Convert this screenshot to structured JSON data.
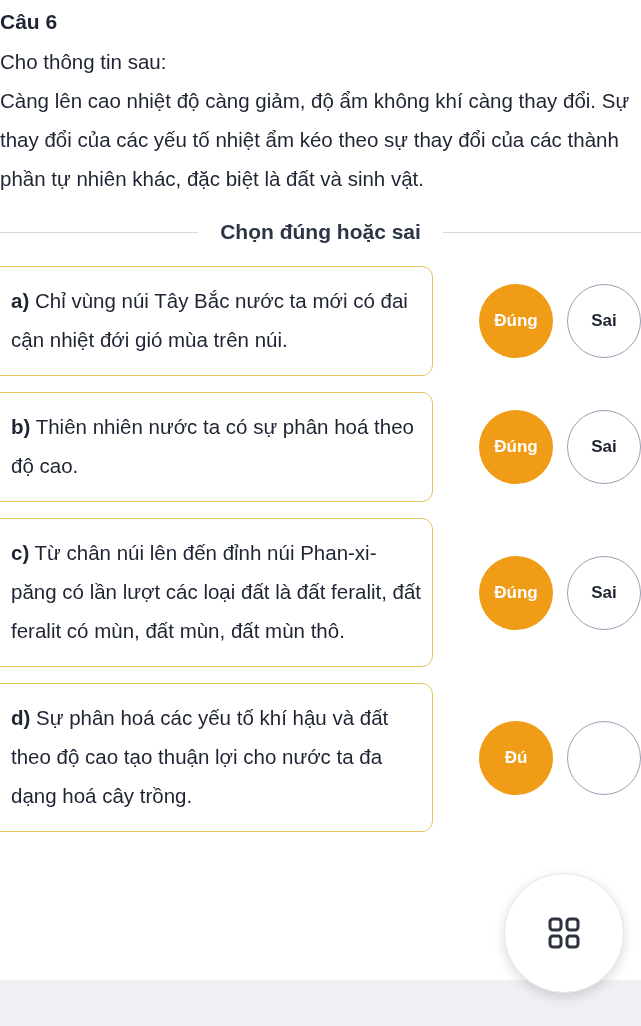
{
  "question": {
    "title": "Câu 6",
    "intro": "Cho thông tin sau:",
    "passage": "Càng lên cao nhiệt độ càng giảm, độ ẩm không khí càng thay đổi. Sự thay đổi của các yếu tố nhiệt ẩm kéo theo sự thay đổi của các thành phần tự nhiên khác, đặc biệt là đất và sinh vật."
  },
  "section_label": "Chọn đúng hoặc sai",
  "statements": [
    {
      "text": "**a)** Chỉ vùng núi Tây Bắc nước ta mới có đai cận nhiệt đới gió mùa trên núi.",
      "options": [
        {
          "label": "Đúng",
          "selected": true
        },
        {
          "label": "Sai",
          "selected": false
        }
      ]
    },
    {
      "text": "**b)** Thiên nhiên nước ta có sự phân hoá theo độ cao.",
      "options": [
        {
          "label": "Đúng",
          "selected": true
        },
        {
          "label": "Sai",
          "selected": false
        }
      ]
    },
    {
      "text": "**c)** Từ chân núi lên đến đỉnh núi Phan-xi-păng có lần lượt các loại đất là đất feralit, đất feralit có mùn, đất mùn, đất mùn thô.",
      "options": [
        {
          "label": "Đúng",
          "selected": true
        },
        {
          "label": "Sai",
          "selected": false
        }
      ]
    },
    {
      "text": "**d)** Sự phân hoá các yếu tố khí hậu và đất theo độ cao tạo thuận lợi cho nước ta đa dạng hoá cây trồng.",
      "options": [
        {
          "label": "Đú",
          "selected": true
        },
        {
          "selected": false
        }
      ]
    }
  ],
  "floating_button": {
    "kind": "grid"
  }
}
